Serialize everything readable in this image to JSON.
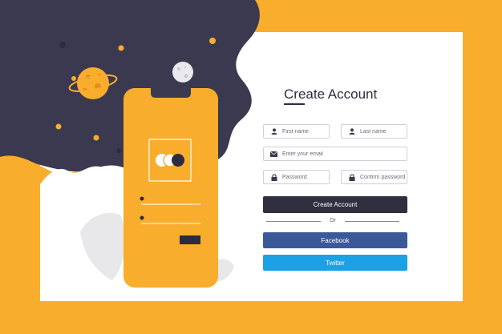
{
  "title": "Create Account",
  "form": {
    "first_name_placeholder": "First name",
    "last_name_placeholder": "Last name",
    "email_placeholder": "Enter your email",
    "password_placeholder": "Password",
    "confirm_password_placeholder": "Confirm password"
  },
  "buttons": {
    "create_account": "Create Account",
    "divider": "Or",
    "facebook": "Facebook",
    "twitter": "Twitter"
  },
  "colors": {
    "background": "#f9ad2c",
    "dark": "#3a3950",
    "primary_button": "#2f2f40",
    "facebook": "#3b5998",
    "twitter": "#1da1e6"
  }
}
